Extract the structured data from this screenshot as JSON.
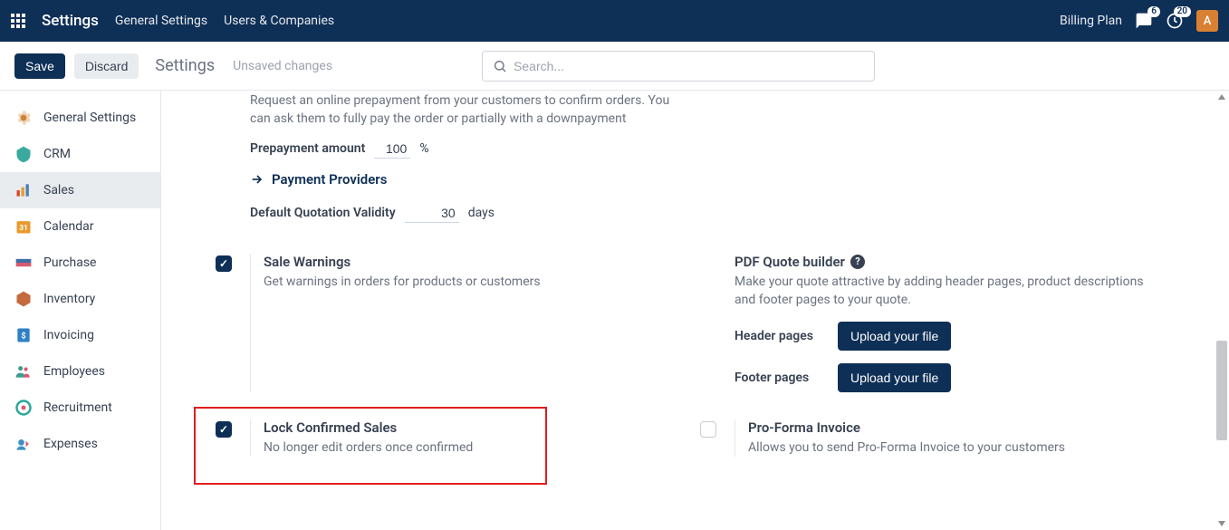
{
  "topnav": {
    "title": "Settings",
    "links": [
      "General Settings",
      "Users & Companies"
    ],
    "billing": "Billing Plan",
    "chat_badge": "6",
    "activity_badge": "20",
    "avatar": "A"
  },
  "controlbar": {
    "save": "Save",
    "discard": "Discard",
    "breadcrumb": "Settings",
    "unsaved": "Unsaved changes",
    "search_placeholder": "Search..."
  },
  "sidebar": {
    "items": [
      {
        "label": "General Settings"
      },
      {
        "label": "CRM"
      },
      {
        "label": "Sales"
      },
      {
        "label": "Calendar"
      },
      {
        "label": "Purchase"
      },
      {
        "label": "Inventory"
      },
      {
        "label": "Invoicing"
      },
      {
        "label": "Employees"
      },
      {
        "label": "Recruitment"
      },
      {
        "label": "Expenses"
      }
    ]
  },
  "settings": {
    "prepayment": {
      "desc": "Request an online prepayment from your customers to confirm orders. You can ask them to fully pay the order or partially with a downpayment",
      "amount_label": "Prepayment amount",
      "amount_value": "100",
      "amount_unit": "%",
      "providers_link": "Payment Providers",
      "default_validity_label": "Default Quotation Validity",
      "default_validity_value": "30",
      "default_validity_unit": "days"
    },
    "sale_warnings": {
      "title": "Sale Warnings",
      "desc": "Get warnings in orders for products or customers"
    },
    "pdf_quote": {
      "title": "PDF Quote builder",
      "desc": "Make your quote attractive by adding header pages, product descriptions and footer pages to your quote.",
      "header_label": "Header pages",
      "footer_label": "Footer pages",
      "upload_btn": "Upload your file"
    },
    "lock_confirmed": {
      "title": "Lock Confirmed Sales",
      "desc": "No longer edit orders once confirmed"
    },
    "proforma": {
      "title": "Pro-Forma Invoice",
      "desc": "Allows you to send Pro-Forma Invoice to your customers"
    }
  }
}
